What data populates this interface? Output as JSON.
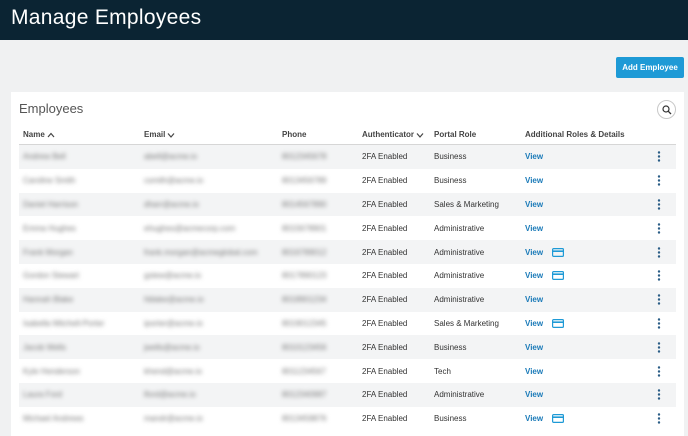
{
  "header": {
    "title": "Manage Employees"
  },
  "toolbar": {
    "add_label": "Add Employee"
  },
  "panel": {
    "title": "Employees"
  },
  "columns": {
    "name": "Name",
    "email": "Email",
    "phone": "Phone",
    "authenticator": "Authenticator",
    "portal_role": "Portal Role",
    "additional": "Additional Roles & Details"
  },
  "colors": {
    "topbar": "#0b2433",
    "accent": "#1e9ad6",
    "link": "#1a7ab8"
  },
  "rows": [
    {
      "name": "Andrew Bell",
      "email": "abell@acme.io",
      "phone": "8012345678",
      "auth": "2FA Enabled",
      "role": "Business",
      "view": "View",
      "card": false
    },
    {
      "name": "Caroline Smith",
      "email": "csmith@acme.io",
      "phone": "8013456789",
      "auth": "2FA Enabled",
      "role": "Business",
      "view": "View",
      "card": false
    },
    {
      "name": "Daniel Harrison",
      "email": "dharr@acme.io",
      "phone": "8014567890",
      "auth": "2FA Enabled",
      "role": "Sales & Marketing",
      "view": "View",
      "card": false
    },
    {
      "name": "Emma Hughes",
      "email": "ehughes@acmecorp.com",
      "phone": "8015678901",
      "auth": "2FA Enabled",
      "role": "Administrative",
      "view": "View",
      "card": false
    },
    {
      "name": "Frank Morgan",
      "email": "frank.morgan@acmeglobal.com",
      "phone": "8016789012",
      "auth": "2FA Enabled",
      "role": "Administrative",
      "view": "View",
      "card": true
    },
    {
      "name": "Gordon Stewart",
      "email": "gstew@acme.io",
      "phone": "8017890123",
      "auth": "2FA Enabled",
      "role": "Administrative",
      "view": "View",
      "card": true
    },
    {
      "name": "Hannah Blake",
      "email": "hblake@acme.io",
      "phone": "8018901234",
      "auth": "2FA Enabled",
      "role": "Administrative",
      "view": "View",
      "card": false
    },
    {
      "name": "Isabella Mitchell-Porter",
      "email": "iporter@acme.io",
      "phone": "8019012345",
      "auth": "2FA Enabled",
      "role": "Sales & Marketing",
      "view": "View",
      "card": true
    },
    {
      "name": "Jacob Wells",
      "email": "jwells@acme.io",
      "phone": "8010123456",
      "auth": "2FA Enabled",
      "role": "Business",
      "view": "View",
      "card": false
    },
    {
      "name": "Kyle Henderson",
      "email": "khend@acme.io",
      "phone": "8011234567",
      "auth": "2FA Enabled",
      "role": "Tech",
      "view": "View",
      "card": false
    },
    {
      "name": "Laura Ford",
      "email": "lford@acme.io",
      "phone": "8012340987",
      "auth": "2FA Enabled",
      "role": "Administrative",
      "view": "View",
      "card": false
    },
    {
      "name": "Michael Andrews",
      "email": "mandr@acme.io",
      "phone": "8013459876",
      "auth": "2FA Enabled",
      "role": "Business",
      "view": "View",
      "card": true
    }
  ]
}
